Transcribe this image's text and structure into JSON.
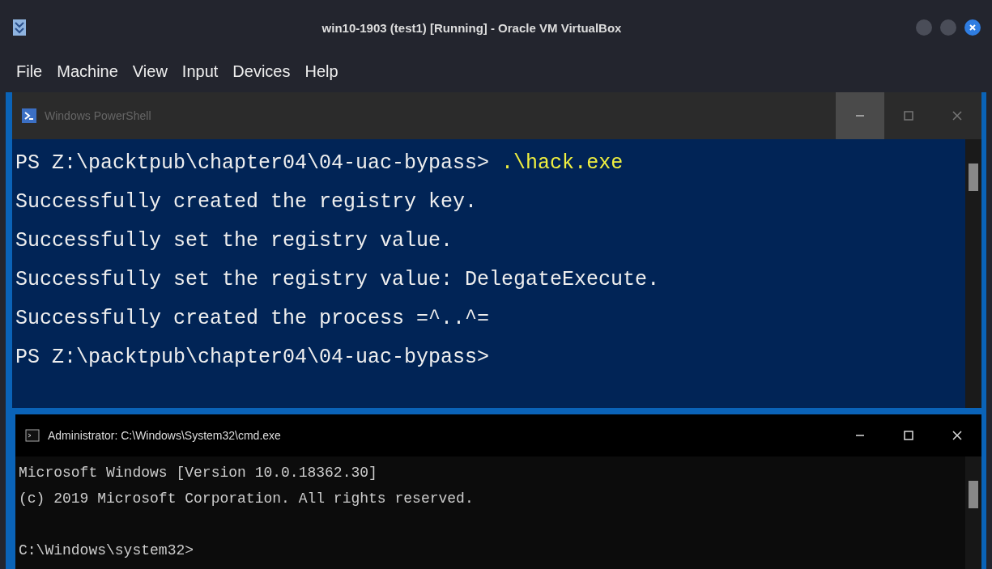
{
  "window": {
    "title": "win10-1903 (test1) [Running] - Oracle VM VirtualBox"
  },
  "menu": [
    "File",
    "Machine",
    "View",
    "Input",
    "Devices",
    "Help"
  ],
  "powershell": {
    "title": "Windows PowerShell",
    "lines": [
      {
        "kind": "command",
        "prompt": "PS Z:\\packtpub\\chapter04\\04-uac-bypass>",
        "command": ".\\hack.exe"
      },
      {
        "kind": "output",
        "text": "Successfully created the registry key."
      },
      {
        "kind": "output",
        "text": "Successfully set the registry value."
      },
      {
        "kind": "output",
        "text": "Successfully set the registry value: DelegateExecute."
      },
      {
        "kind": "output",
        "text": "Successfully created the process =^..^="
      },
      {
        "kind": "command",
        "prompt": "PS Z:\\packtpub\\chapter04\\04-uac-bypass>"
      }
    ]
  },
  "cmd": {
    "title": "Administrator: C:\\Windows\\System32\\cmd.exe",
    "banner": [
      "Microsoft Windows [Version 10.0.18362.30]",
      "(c) 2019 Microsoft Corporation. All rights reserved."
    ],
    "prompt": "C:\\Windows\\system32>"
  }
}
